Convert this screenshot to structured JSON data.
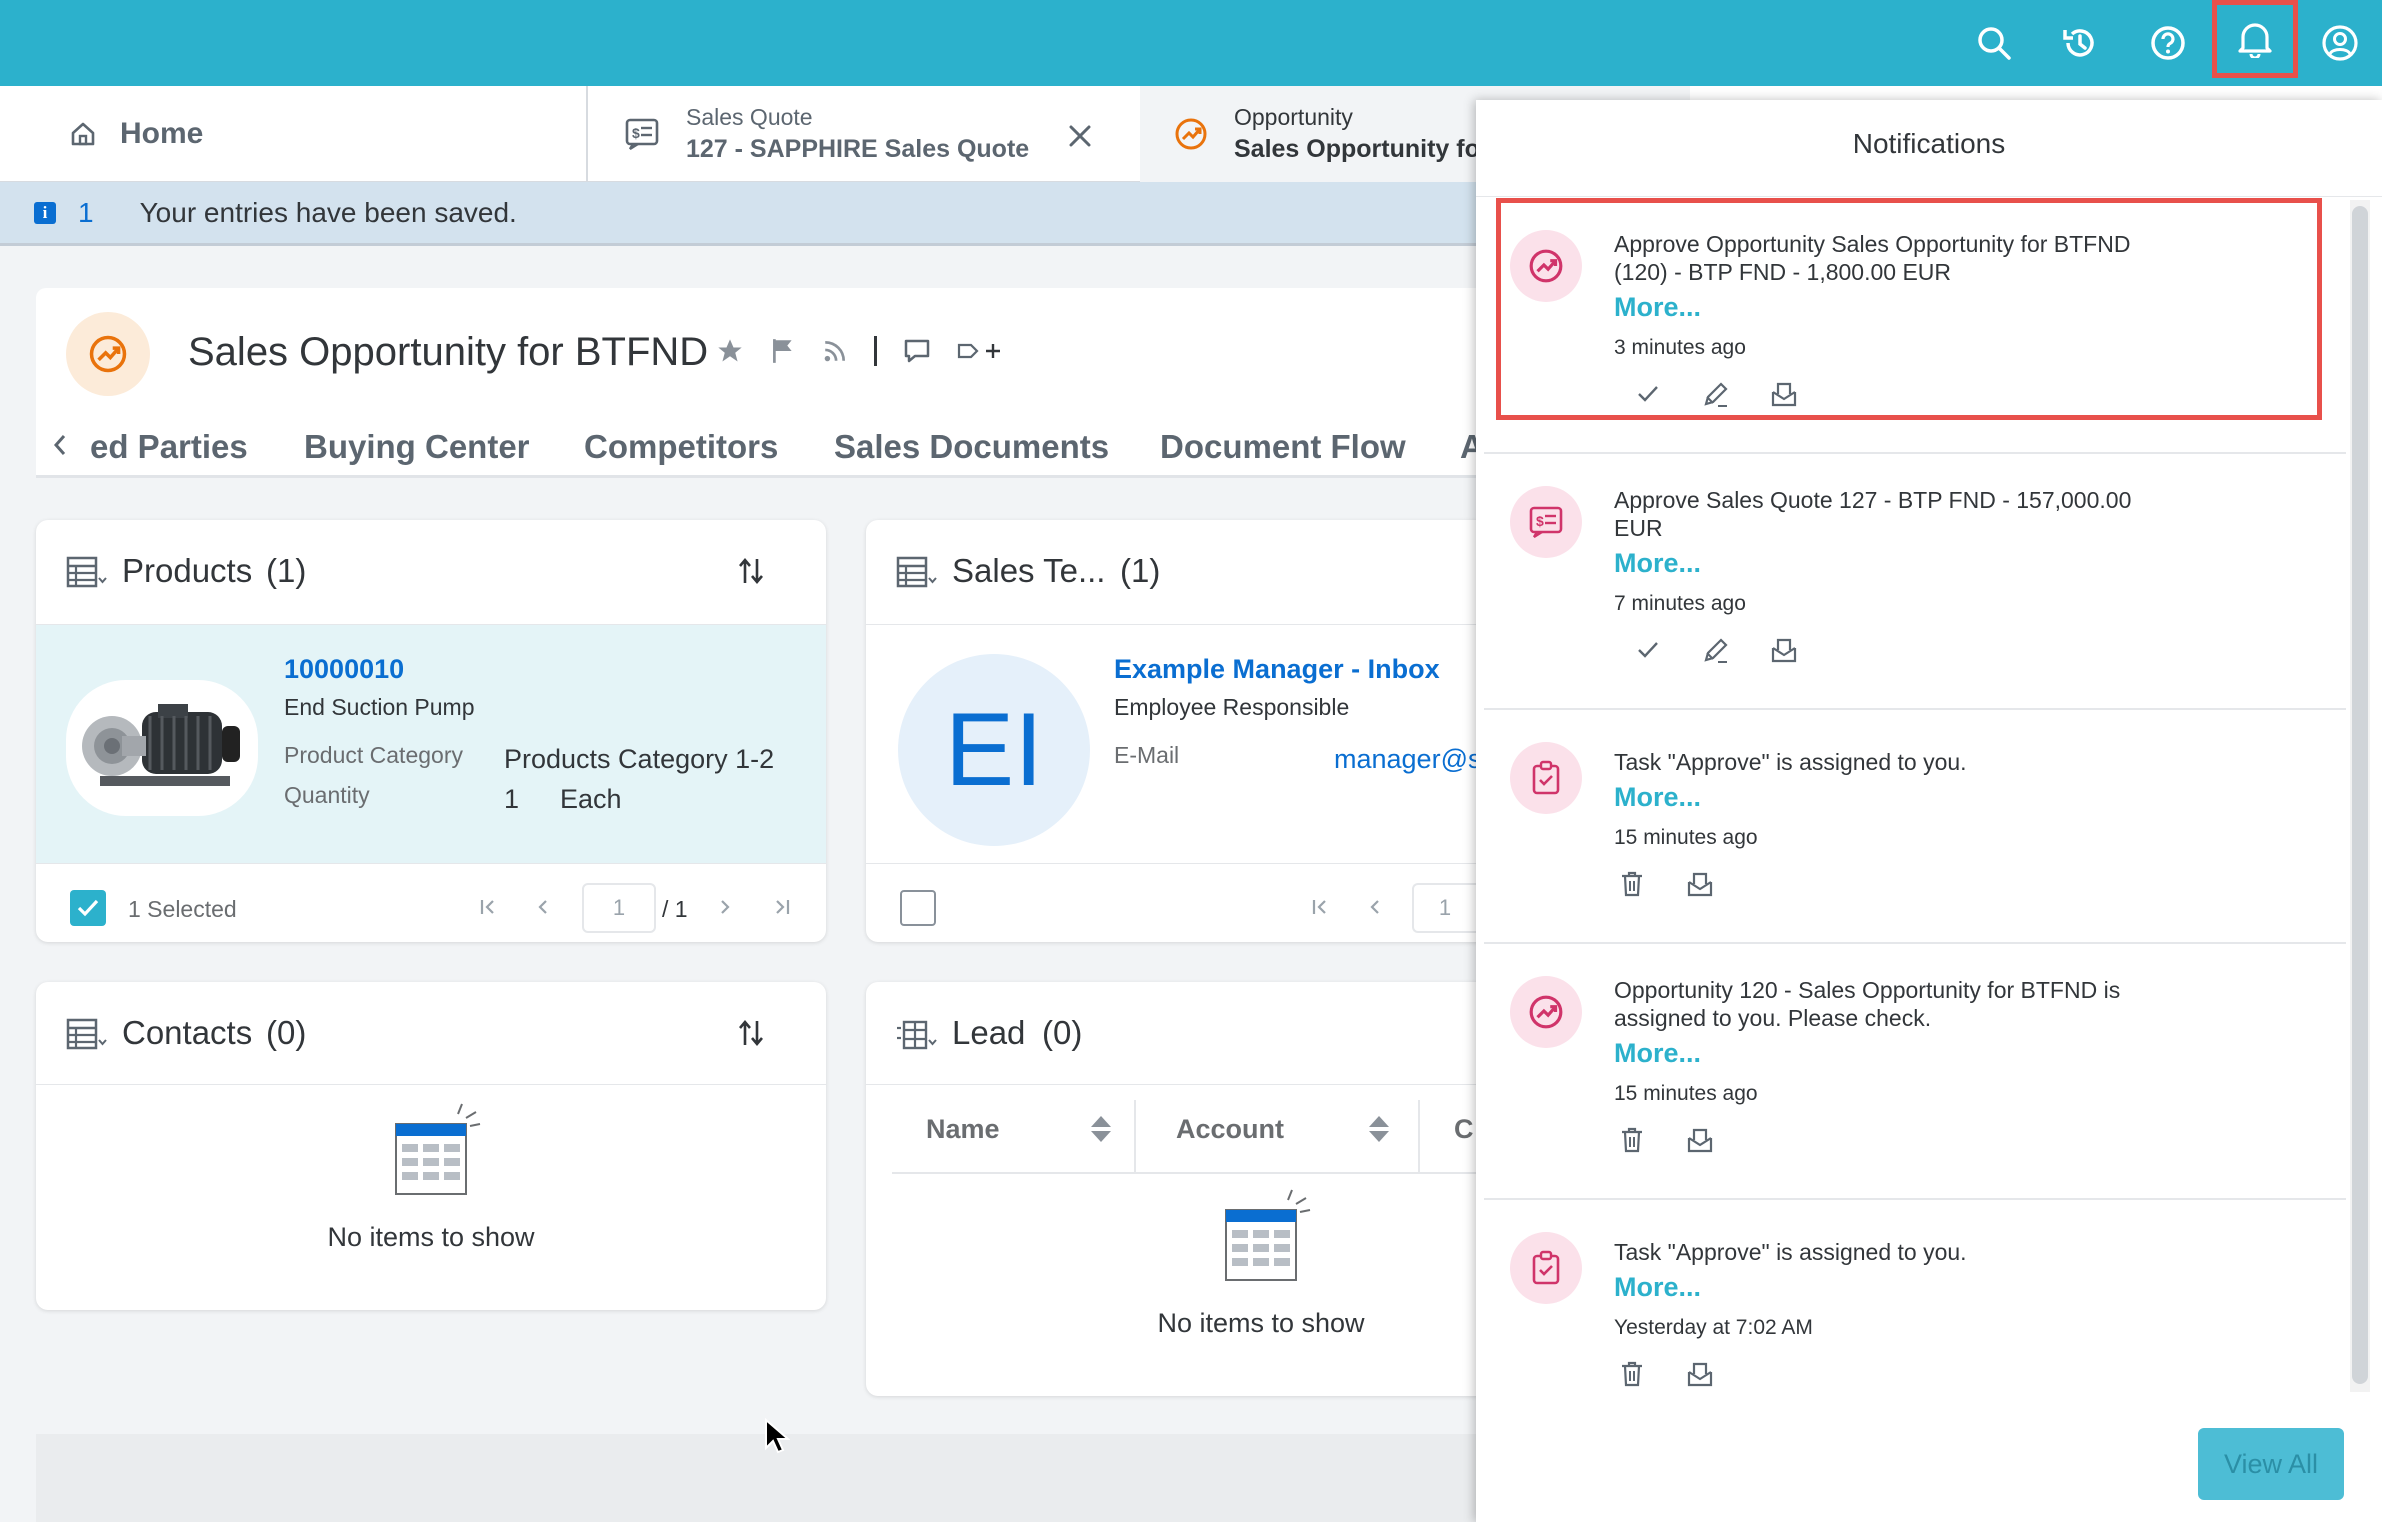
{
  "shell": {
    "colors": {
      "bar": "#2cb1cc",
      "highlight": "#e8504b",
      "accent": "#2cb1cc",
      "link": "#0a6ed1"
    },
    "icons": [
      "search-icon",
      "history-icon",
      "help-icon",
      "bell-icon",
      "user-icon"
    ]
  },
  "tabs": {
    "home": "Home",
    "quote_type": "Sales Quote",
    "quote_title": "127 - SAPPHIRE Sales Quote",
    "opp_type": "Opportunity",
    "opp_title": "Sales Opportunity for"
  },
  "message_strip": {
    "count": "1",
    "text": "Your entries have been saved."
  },
  "object": {
    "title": "Sales Opportunity for BTFND",
    "nav_tabs": [
      "ed Parties",
      "Buying Center",
      "Competitors",
      "Sales Documents",
      "Document Flow",
      "A"
    ]
  },
  "products": {
    "title": "Products",
    "count": "(1)",
    "item": {
      "id": "10000010",
      "name": "End Suction Pump",
      "category_label": "Product Category",
      "category_value": "Products Category 1-2",
      "quantity_label": "Quantity",
      "quantity_value": "1",
      "unit": "Each"
    },
    "selected": "1 Selected",
    "page": "1",
    "page_total": "/ 1"
  },
  "sales_team": {
    "title": "Sales Te...",
    "count": "(1)",
    "initials": "EI",
    "name": "Example Manager - Inbox",
    "role": "Employee Responsible",
    "email_label": "E-Mail",
    "email_value": "manager@s",
    "page": "1"
  },
  "contacts": {
    "title": "Contacts",
    "count": "(0)",
    "empty": "No items to show"
  },
  "lead": {
    "title": "Lead",
    "count": "(0)",
    "col_name": "Name",
    "col_account": "Account",
    "col_c": "C",
    "empty": "No items to show"
  },
  "notifications": {
    "title": "Notifications",
    "view_all": "View All",
    "items": [
      {
        "text": "Approve Opportunity Sales Opportunity for BTFND\n(120) - BTP FND - 1,800.00 EUR",
        "more": "More...",
        "time": "3 minutes ago",
        "icon": "opportunity-icon"
      },
      {
        "text": "Approve Sales Quote 127 - BTP FND - 157,000.00\nEUR",
        "more": "More...",
        "time": "7 minutes ago",
        "icon": "sales-quote-icon"
      },
      {
        "text": "Task \"Approve\" is assigned to you.",
        "more": "More...",
        "time": "15 minutes ago",
        "icon": "task-icon"
      },
      {
        "text": "Opportunity 120 - Sales Opportunity for BTFND is\nassigned to you. Please check.",
        "more": "More...",
        "time": "15 minutes ago",
        "icon": "opportunity-icon"
      },
      {
        "text": "Task \"Approve\" is assigned to you.",
        "more": "More...",
        "time": "Yesterday at 7:02 AM",
        "icon": "task-icon"
      }
    ]
  }
}
